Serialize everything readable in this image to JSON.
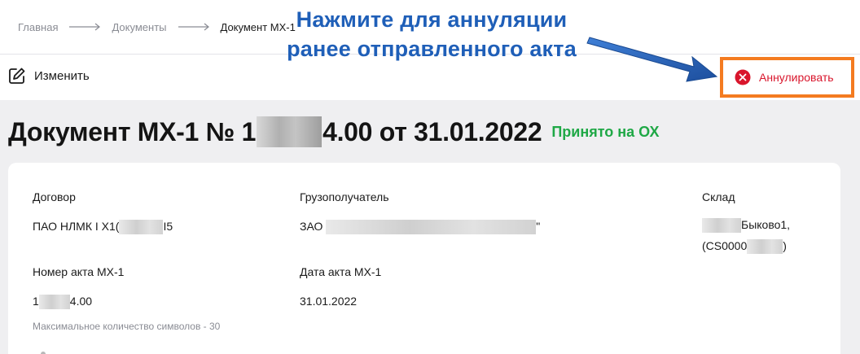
{
  "breadcrumb": {
    "items": [
      "Главная",
      "Документы",
      "Документ МХ-1"
    ]
  },
  "toolbar": {
    "edit_label": "Изменить",
    "annul_label": "Аннулировать"
  },
  "callout": {
    "line1": "Нажмите для аннуляции",
    "line2": "ранее отправленного акта"
  },
  "document": {
    "title_prefix": "Документ МХ-1 № 1",
    "title_suffix": "4.00 от 31.01.2022",
    "status": "Принято на ОХ"
  },
  "fields": {
    "contract": {
      "label": "Договор",
      "value_prefix": "ПАО НЛМК I Х1(",
      "value_suffix": "I5"
    },
    "consignee": {
      "label": "Грузополучатель",
      "value_prefix": "ЗАО",
      "value_suffix": "\""
    },
    "warehouse": {
      "label": "Склад",
      "line1_suffix": "Быково1,",
      "line2_prefix": "(CS0000",
      "line2_suffix": ")"
    },
    "act_number": {
      "label": "Номер акта МХ-1",
      "value_prefix": "1",
      "value_suffix": "4.00",
      "hint": "Максимальное количество символов - 30"
    },
    "act_date": {
      "label": "Дата акта МХ-1",
      "value": "31.01.2022"
    }
  },
  "colors": {
    "accent_orange": "#f47b20",
    "annul_red": "#d9162c",
    "status_green": "#1fa846",
    "callout_blue": "#1f5fb8"
  }
}
